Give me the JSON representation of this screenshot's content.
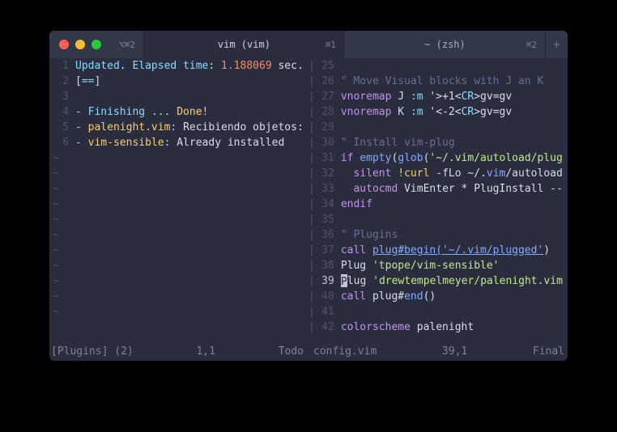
{
  "titlebar": {
    "shortcut_left": "⌥⌘2",
    "tabs": [
      {
        "label": "vim (vim)",
        "shortcut": "⌘1"
      },
      {
        "label": "~ (zsh)",
        "shortcut": "⌘2"
      }
    ]
  },
  "left_pane": {
    "lines": [
      {
        "n": "1",
        "tokens": [
          [
            "c-teal",
            "Updated"
          ],
          [
            "c-white",
            ". "
          ],
          [
            "c-teal",
            "Elapsed time"
          ],
          [
            "c-white",
            ": "
          ],
          [
            "c-orange",
            "1.188069"
          ],
          [
            "c-white",
            " sec."
          ]
        ]
      },
      {
        "n": "2",
        "tokens": [
          [
            "c-white",
            "["
          ],
          [
            "c-cyan",
            "=="
          ],
          [
            "c-white",
            "]"
          ]
        ]
      },
      {
        "n": "3",
        "tokens": []
      },
      {
        "n": "4",
        "tokens": [
          [
            "c-teal",
            "- Finishing ... "
          ],
          [
            "c-yellow",
            "Done!"
          ]
        ]
      },
      {
        "n": "5",
        "tokens": [
          [
            "c-teal",
            "- "
          ],
          [
            "c-yellow",
            "palenight.vim"
          ],
          [
            "c-teal",
            ": "
          ],
          [
            "c-white",
            "Recibiendo objetos:"
          ]
        ]
      },
      {
        "n": "6",
        "tokens": [
          [
            "c-teal",
            "- "
          ],
          [
            "c-yellow",
            "vim-sensible"
          ],
          [
            "c-teal",
            ": "
          ],
          [
            "c-white",
            "Already installed"
          ]
        ]
      }
    ],
    "tilde_count": 11,
    "status": {
      "name": "[Plugins] (2)",
      "pos": "1,1",
      "mode": "Todo"
    }
  },
  "right_pane": {
    "lines": [
      {
        "n": "25",
        "tokens": []
      },
      {
        "n": "26",
        "tokens": [
          [
            "c-grey",
            "\" Move Visual blocks with J an K"
          ]
        ]
      },
      {
        "n": "27",
        "tokens": [
          [
            "c-purple",
            "vnoremap"
          ],
          [
            "c-white",
            " J "
          ],
          [
            "c-teal",
            ":m"
          ],
          [
            "c-white",
            " '>+1<"
          ],
          [
            "c-cyan",
            "CR"
          ],
          [
            "c-white",
            ">gv=gv"
          ]
        ]
      },
      {
        "n": "28",
        "tokens": [
          [
            "c-purple",
            "vnoremap"
          ],
          [
            "c-white",
            " K "
          ],
          [
            "c-teal",
            ":m"
          ],
          [
            "c-white",
            " '<-2<"
          ],
          [
            "c-cyan",
            "CR"
          ],
          [
            "c-white",
            ">gv=gv"
          ]
        ]
      },
      {
        "n": "29",
        "tokens": []
      },
      {
        "n": "30",
        "tokens": [
          [
            "c-grey",
            "\" Install vim-plug"
          ]
        ]
      },
      {
        "n": "31",
        "tokens": [
          [
            "c-purple",
            "if"
          ],
          [
            "c-white",
            " "
          ],
          [
            "c-blue",
            "empty"
          ],
          [
            "c-white",
            "("
          ],
          [
            "c-blue",
            "glob"
          ],
          [
            "c-white",
            "("
          ],
          [
            "c-green",
            "'~/.vim/autoload/plug"
          ]
        ]
      },
      {
        "n": "32",
        "tokens": [
          [
            "c-white",
            "  "
          ],
          [
            "c-purple",
            "silent"
          ],
          [
            "c-white",
            " "
          ],
          [
            "c-yellow",
            "!curl"
          ],
          [
            "c-white",
            " -fLo ~/."
          ],
          [
            "c-blue",
            "vim"
          ],
          [
            "c-white",
            "/autoload"
          ]
        ]
      },
      {
        "n": "33",
        "tokens": [
          [
            "c-white",
            "  "
          ],
          [
            "c-purple",
            "autocmd"
          ],
          [
            "c-white",
            " VimEnter * PlugInstall --"
          ]
        ]
      },
      {
        "n": "34",
        "tokens": [
          [
            "c-purple",
            "endif"
          ]
        ]
      },
      {
        "n": "35",
        "tokens": []
      },
      {
        "n": "36",
        "tokens": [
          [
            "c-grey",
            "\" Plugins"
          ]
        ]
      },
      {
        "n": "37",
        "tokens": [
          [
            "c-purple",
            "call"
          ],
          [
            "c-white",
            " "
          ],
          [
            "c-link",
            "plug#begin('~/.vim/plugged'"
          ],
          [
            "c-white",
            ")"
          ]
        ]
      },
      {
        "n": "38",
        "tokens": [
          [
            "c-white",
            "Plug "
          ],
          [
            "c-green",
            "'tpope/vim-sensible'"
          ]
        ]
      },
      {
        "n": "39",
        "cursor": true,
        "tokens": [
          [
            "c-white",
            "lug "
          ],
          [
            "c-green",
            "'drewtempelmeyer/palenight.vim"
          ]
        ]
      },
      {
        "n": "40",
        "tokens": [
          [
            "c-purple",
            "call"
          ],
          [
            "c-white",
            " plug#"
          ],
          [
            "c-blue",
            "end"
          ],
          [
            "c-white",
            "()"
          ]
        ]
      },
      {
        "n": "41",
        "tokens": []
      },
      {
        "n": "42",
        "tokens": [
          [
            "c-purple",
            "colorscheme"
          ],
          [
            "c-white",
            " palenight"
          ]
        ]
      }
    ],
    "status": {
      "name": "config.vim",
      "pos": "39,1",
      "mode": "Final"
    }
  }
}
